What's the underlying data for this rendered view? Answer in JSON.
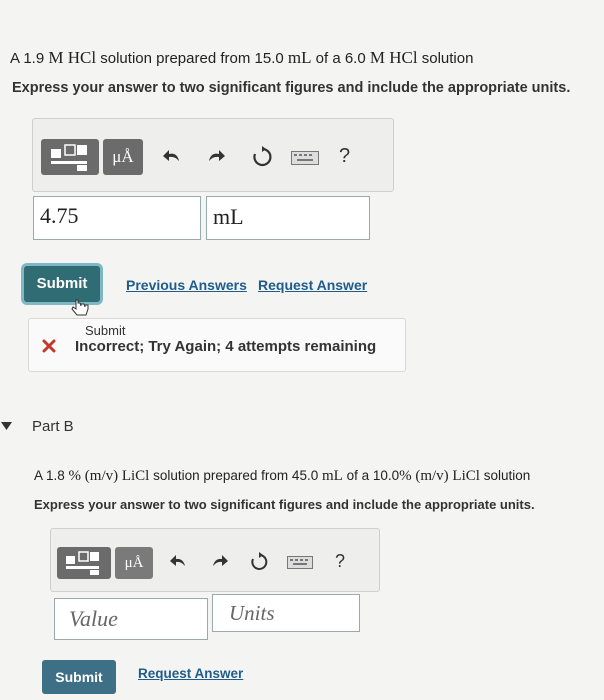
{
  "part_a": {
    "question_prefix": "A 1.9 ",
    "question_formula1": "M HCl",
    "question_mid": " solution prepared from 15.0 ",
    "question_unit": "mL",
    "question_mid2": " of a 6.0 ",
    "question_formula2": "M  HCl",
    "question_suffix": " solution",
    "instruction": "Express your answer to two significant figures and include the appropriate units.",
    "value_input": "4.75",
    "units_input": "mL",
    "submit_label": "Submit",
    "previous_answers_label": "Previous Answers",
    "request_answer_label": "Request Answer",
    "feedback_title": "Submit",
    "feedback_message": "Incorrect; Try Again; 4 attempts remaining"
  },
  "toolbar": {
    "mu_label": "μÅ",
    "help_label": "?"
  },
  "part_b": {
    "heading": "Part B",
    "question_prefix": "A 1.8 ",
    "question_pct1": "% (m/v) LiCl",
    "question_mid": " solution prepared from 45.0 ",
    "question_unit": "mL",
    "question_mid2": " of a 10.0",
    "question_pct2": "% (m/v) LiCl",
    "question_suffix": " solution",
    "instruction": "Express your answer to two significant figures and include the appropriate units.",
    "value_placeholder": "Value",
    "units_placeholder": "Units",
    "submit_label": "Submit",
    "request_answer_label": "Request Answer"
  },
  "colors": {
    "submit_active": "#2f6c73",
    "submit_inactive": "#3d6f87",
    "error_red": "#c0392b",
    "link": "#1f5c8c"
  }
}
